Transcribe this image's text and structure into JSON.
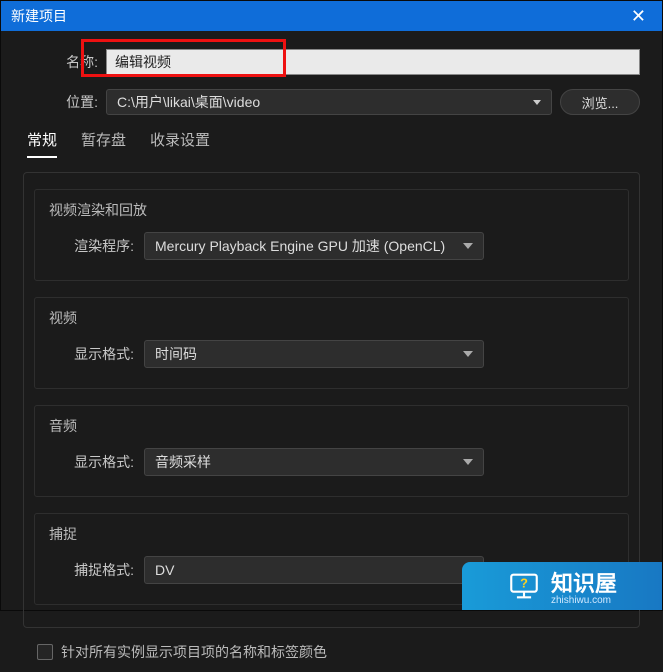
{
  "window": {
    "title": "新建项目",
    "close": "✕"
  },
  "form": {
    "name_label": "名称:",
    "name_value": "编辑视频",
    "location_label": "位置:",
    "location_value": "C:\\用户\\likai\\桌面\\video",
    "browse": "浏览..."
  },
  "tabs": {
    "general": "常规",
    "scratch": "暂存盘",
    "ingest": "收录设置"
  },
  "sections": {
    "video_render": {
      "title": "视频渲染和回放",
      "renderer_label": "渲染程序:",
      "renderer_value": "Mercury Playback Engine GPU 加速 (OpenCL)"
    },
    "video": {
      "title": "视频",
      "display_label": "显示格式:",
      "display_value": "时间码"
    },
    "audio": {
      "title": "音频",
      "display_label": "显示格式:",
      "display_value": "音频采样"
    },
    "capture": {
      "title": "捕捉",
      "capture_label": "捕捉格式:",
      "capture_value": "DV"
    }
  },
  "checkbox": {
    "label": "针对所有实例显示项目项的名称和标签颜色"
  },
  "watermark": {
    "main": "知识屋",
    "sub": "zhishiwu.com"
  }
}
